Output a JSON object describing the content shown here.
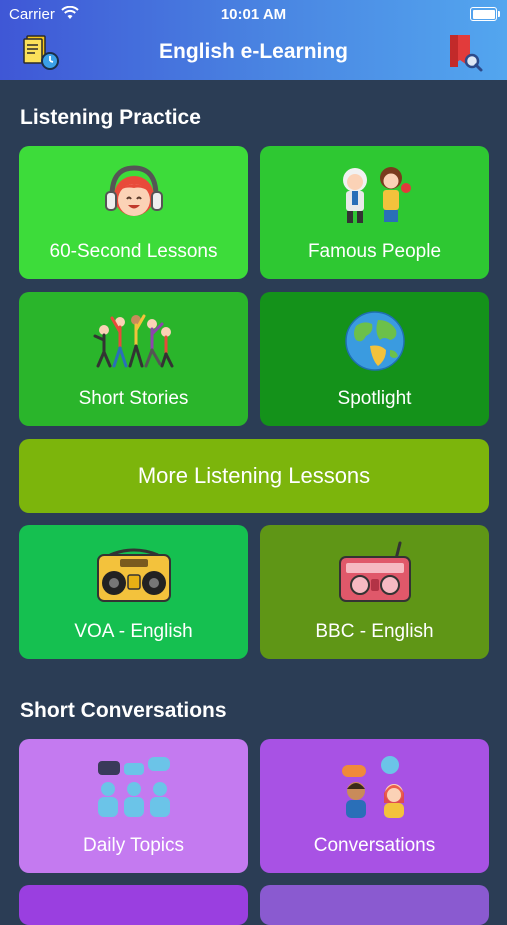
{
  "status_bar": {
    "carrier": "Carrier",
    "time": "10:01 AM"
  },
  "nav": {
    "title": "English e-Learning",
    "left_icon": "notes-clock-icon",
    "right_icon": "bookmark-search-icon"
  },
  "colors": {
    "nav_gradient": [
      "#3f57d6",
      "#53a6ef"
    ],
    "background": "#2b3d55",
    "green_light": "#3ddc3a",
    "green_medium": "#2ab52b",
    "green_dark": "#14921a",
    "olive": "#7cb50c",
    "purple_light": "#c47af0",
    "purple_medium": "#a852e4"
  },
  "sections": {
    "listening": {
      "title": "Listening Practice",
      "tiles": [
        {
          "label": "60-Second Lessons",
          "icon": "headphones-girl-icon"
        },
        {
          "label": "Famous People",
          "icon": "famous-people-icon"
        },
        {
          "label": "Short Stories",
          "icon": "dancing-people-icon"
        },
        {
          "label": "Spotlight",
          "icon": "globe-icon"
        }
      ],
      "more_button": "More Listening Lessons",
      "radio_tiles": [
        {
          "label": "VOA - English",
          "icon": "boombox-icon"
        },
        {
          "label": "BBC - English",
          "icon": "radio-icon"
        }
      ]
    },
    "conversations": {
      "title": "Short Conversations",
      "tiles": [
        {
          "label": "Daily Topics",
          "icon": "chat-group-icon"
        },
        {
          "label": "Conversations",
          "icon": "two-people-talking-icon"
        }
      ]
    }
  }
}
